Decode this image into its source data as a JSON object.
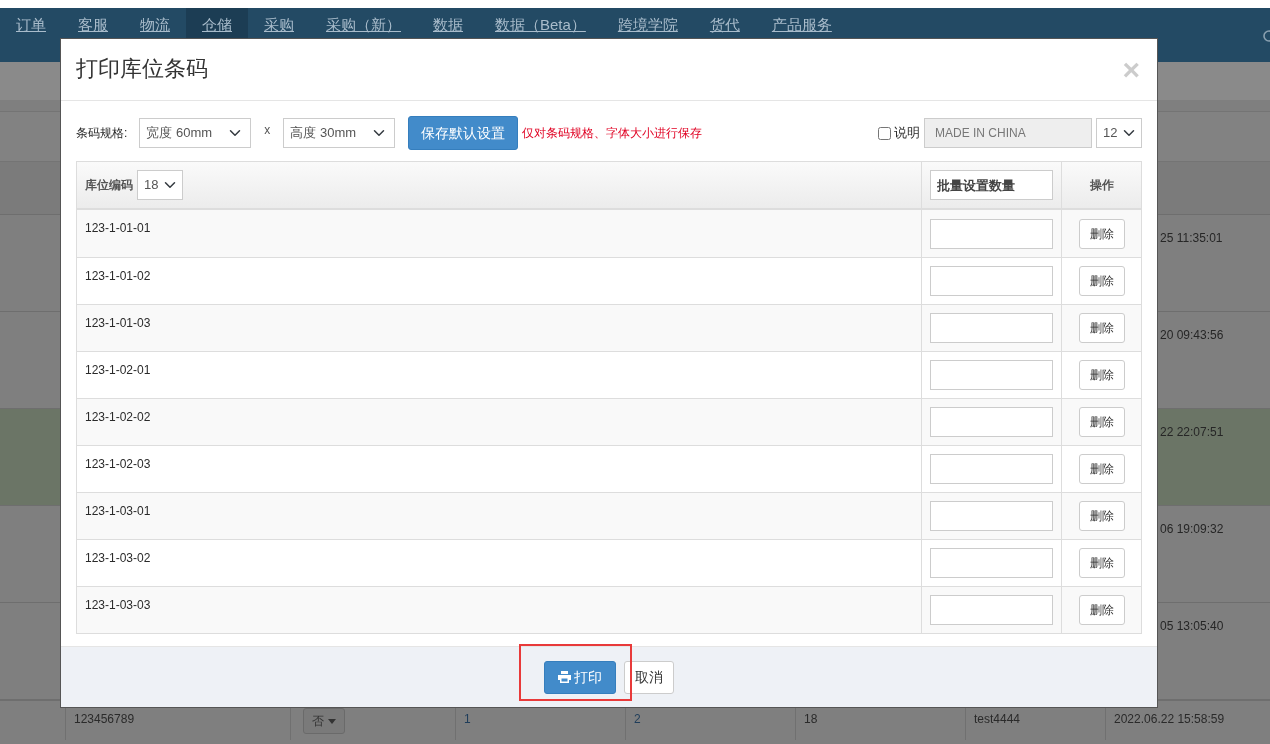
{
  "nav": [
    {
      "label": "订单",
      "selected": false
    },
    {
      "label": "客服",
      "selected": false
    },
    {
      "label": "物流",
      "selected": false
    },
    {
      "label": "仓储",
      "selected": true
    },
    {
      "label": "采购",
      "selected": false
    },
    {
      "label": "采购（新）",
      "selected": false
    },
    {
      "label": "数据",
      "selected": false
    },
    {
      "label": "数据（Beta）",
      "selected": false
    },
    {
      "label": "跨境学院",
      "selected": false
    },
    {
      "label": "货代",
      "selected": false
    },
    {
      "label": "产品服务",
      "selected": false
    }
  ],
  "background_rows": [
    {
      "time": "25 11:35:01",
      "highlighted": false
    },
    {
      "time": "20 09:43:56",
      "highlighted": false
    },
    {
      "time": "22 22:07:51",
      "highlighted": true
    },
    {
      "time": "06 19:09:32",
      "highlighted": false
    },
    {
      "time": "05 13:05:40",
      "highlighted": false
    }
  ],
  "background_last_row": {
    "code": "123456789",
    "choice": "否",
    "col_3": "1",
    "col_4": "2",
    "col_5": "18",
    "user": "test4444",
    "time": "2022.06.22 15:58:59"
  },
  "modal": {
    "title": "打印库位条码",
    "close": "×",
    "toolbar": {
      "spec_label": "条码规格:",
      "width": "宽度 60mm",
      "times": "x",
      "height": "高度 30mm",
      "save_button": "保存默认设置",
      "note": "仅对条码规格、字体大小进行保存",
      "caption_checkbox": {
        "label": "说明",
        "checked": false
      },
      "caption_field": {
        "value": "MADE IN CHINA",
        "disabled": true
      },
      "font_size": "12"
    },
    "table": {
      "code_header": "库位编码",
      "code_size": "18",
      "qty_placeholder": "批量设置数量",
      "action_header": "操作",
      "rows": [
        {
          "code": "123-1-01-01",
          "action": "删除"
        },
        {
          "code": "123-1-01-02",
          "action": "删除"
        },
        {
          "code": "123-1-01-03",
          "action": "删除"
        },
        {
          "code": "123-1-02-01",
          "action": "删除"
        },
        {
          "code": "123-1-02-02",
          "action": "删除"
        },
        {
          "code": "123-1-02-03",
          "action": "删除"
        },
        {
          "code": "123-1-03-01",
          "action": "删除"
        },
        {
          "code": "123-1-03-02",
          "action": "删除"
        },
        {
          "code": "123-1-03-03",
          "action": "删除"
        }
      ]
    },
    "footer": {
      "print_button": "打印",
      "print_highlighted": true,
      "cancel_button": "取消"
    }
  }
}
